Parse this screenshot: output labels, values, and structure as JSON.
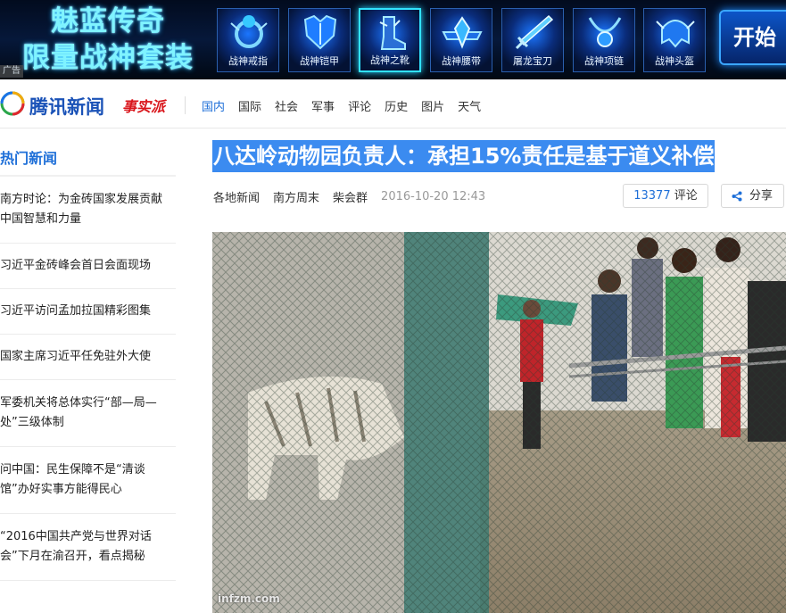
{
  "ad": {
    "title_line1": "魅蓝传奇",
    "title_line2": "限量战神套装",
    "tag": "广告",
    "items": [
      {
        "label": "战神戒指",
        "icon": "ring-icon"
      },
      {
        "label": "战神铠甲",
        "icon": "armor-icon"
      },
      {
        "label": "战神之靴",
        "icon": "boots-icon"
      },
      {
        "label": "战神腰带",
        "icon": "belt-icon"
      },
      {
        "label": "屠龙宝刀",
        "icon": "sword-icon"
      },
      {
        "label": "战神项链",
        "icon": "necklace-icon"
      },
      {
        "label": "战神头盔",
        "icon": "helmet-icon"
      }
    ],
    "selected_index": 2,
    "start_label": "开始",
    "accent": "#31e3ff"
  },
  "nav": {
    "logo_text": "腾讯新闻",
    "logo_badge": "事实派",
    "links": [
      "国内",
      "国际",
      "社会",
      "军事",
      "评论",
      "历史",
      "图片",
      "天气"
    ],
    "active_index": 0,
    "accent": "#1e6fd8"
  },
  "sidebar": {
    "title": "热门新闻",
    "items": [
      {
        "line1": "南方时论：为金砖国家发展贡献",
        "line2": "中国智慧和力量"
      },
      {
        "line1": "习近平金砖峰会首日会面现场",
        "line2": ""
      },
      {
        "line1": "习近平访问孟加拉国精彩图集",
        "line2": ""
      },
      {
        "line1": "国家主席习近平任免驻外大使",
        "line2": ""
      },
      {
        "line1": "军委机关将总体实行“部—局—",
        "line2": "处”三级体制"
      },
      {
        "line1": "问中国：民生保障不是“清谈",
        "line2": "馆”办好实事方能得民心"
      },
      {
        "line1": "“2016中国共产党与世界对话",
        "line2": "会”下月在渝召开，看点揭秘"
      }
    ]
  },
  "article": {
    "headline": "八达岭动物园负责人：承担15%责任是基于道义补偿",
    "headline_highlight": "#3b8bf0",
    "sources": [
      "各地新闻",
      "南方周末",
      "柴会群"
    ],
    "time": "2016-10-20 12:43",
    "comment_count": "13377",
    "comment_label": "评论",
    "share_label": "分享",
    "photo_watermark": "infzm.com"
  }
}
